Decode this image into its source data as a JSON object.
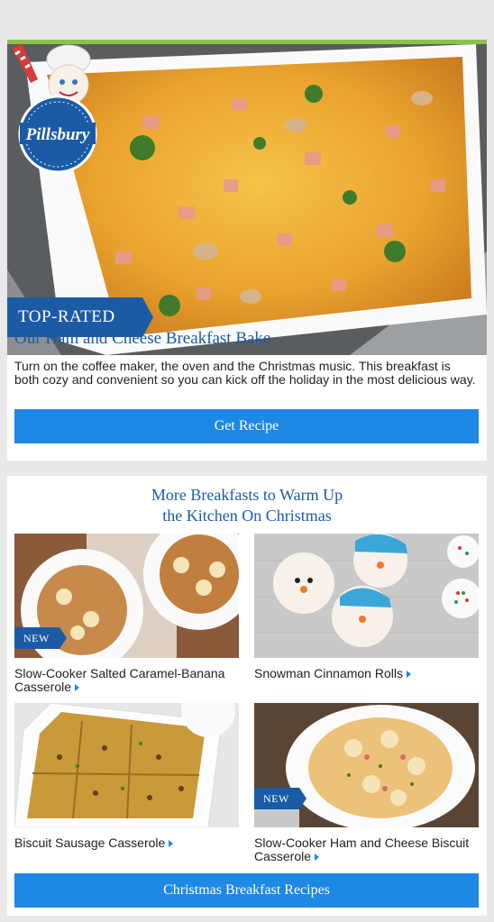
{
  "brand": {
    "logo_text": "Pillsbury"
  },
  "hero": {
    "badge": "TOP-RATED",
    "title": "Our Ham and Cheese Breakfast Bake",
    "description": "Turn on the coffee maker, the oven and the Christmas music. This breakfast is both cozy and convenient so you can kick off the holiday in the most delicious way.",
    "button_label": "Get Recipe"
  },
  "more": {
    "title_line1": "More Breakfasts to Warm Up",
    "title_line2": "the Kitchen On Christmas",
    "tiles": [
      {
        "caption": "Slow-Cooker Salted Caramel-Banana Casserole",
        "badge": "NEW"
      },
      {
        "caption": "Snowman Cinnamon Rolls",
        "badge": ""
      },
      {
        "caption": "Biscuit Sausage Casserole",
        "badge": ""
      },
      {
        "caption": "Slow-Cooker Ham and Cheese Biscuit Casserole",
        "badge": "NEW"
      }
    ],
    "button_label": "Christmas Breakfast Recipes"
  },
  "colors": {
    "brand_blue": "#1b5ba6",
    "button_blue": "#1e88e5",
    "accent_green": "#8bc34a"
  }
}
